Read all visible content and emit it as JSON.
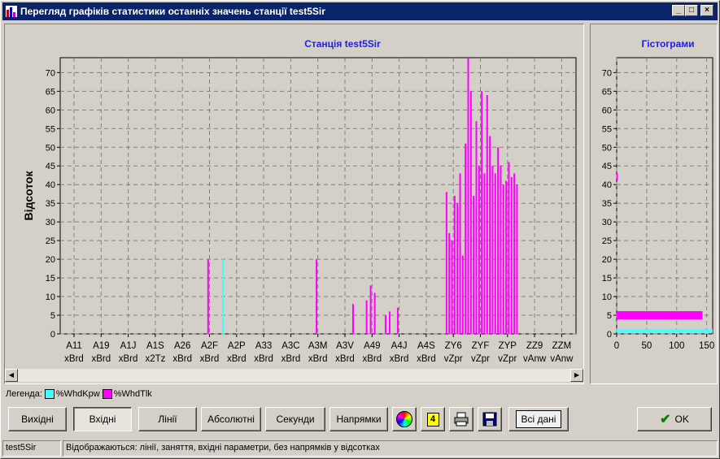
{
  "window": {
    "title": "Перегляд графіків статистики останніх значень станції test5Sir"
  },
  "colors": {
    "cyan": "#40ffff",
    "magenta": "#ff00ff",
    "chart_title": "#2020e0",
    "titlebar": "#0a246a"
  },
  "icons": {
    "app": "bar-chart-icon",
    "minimize": "minimize-icon",
    "maximize": "maximize-icon",
    "close": "close-icon"
  },
  "legend": {
    "label": "Легенда:",
    "items": [
      {
        "name": "%WhdKpw",
        "color": "#40ffff"
      },
      {
        "name": "%WhdTlk",
        "color": "#ff00ff"
      }
    ]
  },
  "buttons": {
    "outgoing": "Вихідні",
    "incoming": "Вхідні",
    "lines": "Лінії",
    "absolute": "Абсолютні",
    "seconds": "Секунди",
    "directions": "Напрямки",
    "color_icon": "color-wheel-icon",
    "label_icon": "label-4-icon",
    "label_icon_text": "4",
    "print_icon": "printer-icon",
    "save_icon": "floppy-disk-icon",
    "all_data": "Всі дані",
    "ok": "OK"
  },
  "status": {
    "station": "test5Sir",
    "message": "Відображаються: лінії, заняття, вхідні параметри, без напрямків у відсотках"
  },
  "chart_data": [
    {
      "type": "bar",
      "title": "Станція test5Sir",
      "ylabel": "Відсоток",
      "ylim": [
        0,
        74
      ],
      "yticks": [
        0,
        5,
        10,
        15,
        20,
        25,
        30,
        35,
        40,
        45,
        50,
        55,
        60,
        65,
        70
      ],
      "grid": true,
      "xticks": [
        {
          "top": "A11",
          "bottom": "xBrd"
        },
        {
          "top": "A19",
          "bottom": "xBrd"
        },
        {
          "top": "A1J",
          "bottom": "xBrd"
        },
        {
          "top": "A1S",
          "bottom": "x2Tz"
        },
        {
          "top": "A26",
          "bottom": "xBrd"
        },
        {
          "top": "A2F",
          "bottom": "xBrd"
        },
        {
          "top": "A2P",
          "bottom": "xBrd"
        },
        {
          "top": "A33",
          "bottom": "xBrd"
        },
        {
          "top": "A3C",
          "bottom": "xBrd"
        },
        {
          "top": "A3M",
          "bottom": "xBrd"
        },
        {
          "top": "A3V",
          "bottom": "xBrd"
        },
        {
          "top": "A49",
          "bottom": "xBrd"
        },
        {
          "top": "A4J",
          "bottom": "xBrd"
        },
        {
          "top": "A4S",
          "bottom": "xBrd"
        },
        {
          "top": "ZY6",
          "bottom": "vZpr"
        },
        {
          "top": "ZYF",
          "bottom": "vZpr"
        },
        {
          "top": "ZYP",
          "bottom": "vZpr"
        },
        {
          "top": "ZZ9",
          "bottom": "vAnw"
        },
        {
          "top": "ZZM",
          "bottom": "vAnw"
        }
      ],
      "series": [
        {
          "name": "%WhdKpw",
          "color": "#40ffff",
          "points": [
            [
              5.5,
              20
            ]
          ]
        },
        {
          "name": "%WhdTlk",
          "color": "#ff00ff",
          "points": [
            [
              4.95,
              20
            ],
            [
              8.95,
              20
            ],
            [
              10.3,
              8
            ],
            [
              10.8,
              9
            ],
            [
              10.95,
              13
            ],
            [
              11.1,
              11
            ],
            [
              11.5,
              5
            ],
            [
              11.65,
              6
            ],
            [
              11.95,
              7
            ],
            [
              13.75,
              38
            ],
            [
              13.85,
              27
            ],
            [
              13.95,
              25
            ],
            [
              14.05,
              37
            ],
            [
              14.15,
              35
            ],
            [
              14.25,
              43
            ],
            [
              14.35,
              21
            ],
            [
              14.45,
              51
            ],
            [
              14.55,
              74
            ],
            [
              14.65,
              65
            ],
            [
              14.75,
              37
            ],
            [
              14.85,
              57
            ],
            [
              14.95,
              45
            ],
            [
              15.05,
              65
            ],
            [
              15.15,
              43
            ],
            [
              15.25,
              64
            ],
            [
              15.35,
              53
            ],
            [
              15.45,
              45
            ],
            [
              15.55,
              43
            ],
            [
              15.65,
              50
            ],
            [
              15.75,
              45
            ],
            [
              15.85,
              40
            ],
            [
              15.95,
              41
            ],
            [
              16.05,
              46
            ],
            [
              16.15,
              42
            ],
            [
              16.25,
              43
            ],
            [
              16.35,
              40
            ]
          ]
        }
      ]
    },
    {
      "type": "bar",
      "title": "Гістограми",
      "orientation": "horizontal",
      "xlim": [
        0,
        160
      ],
      "xticks": [
        0,
        50,
        100,
        150
      ],
      "ylim": [
        0,
        74
      ],
      "yticks": [
        0,
        5,
        10,
        15,
        20,
        25,
        30,
        35,
        40,
        45,
        50,
        55,
        60,
        65,
        70
      ],
      "grid": true,
      "series": [
        {
          "name": "%WhdKpw",
          "color": "#40ffff",
          "bars": [
            {
              "y": 0.8,
              "count": 160
            }
          ]
        },
        {
          "name": "%WhdTlk",
          "color": "#ff00ff",
          "bars": [
            {
              "y": 5,
              "count": 143
            },
            {
              "y": 42,
              "count": 2
            }
          ]
        }
      ]
    }
  ]
}
